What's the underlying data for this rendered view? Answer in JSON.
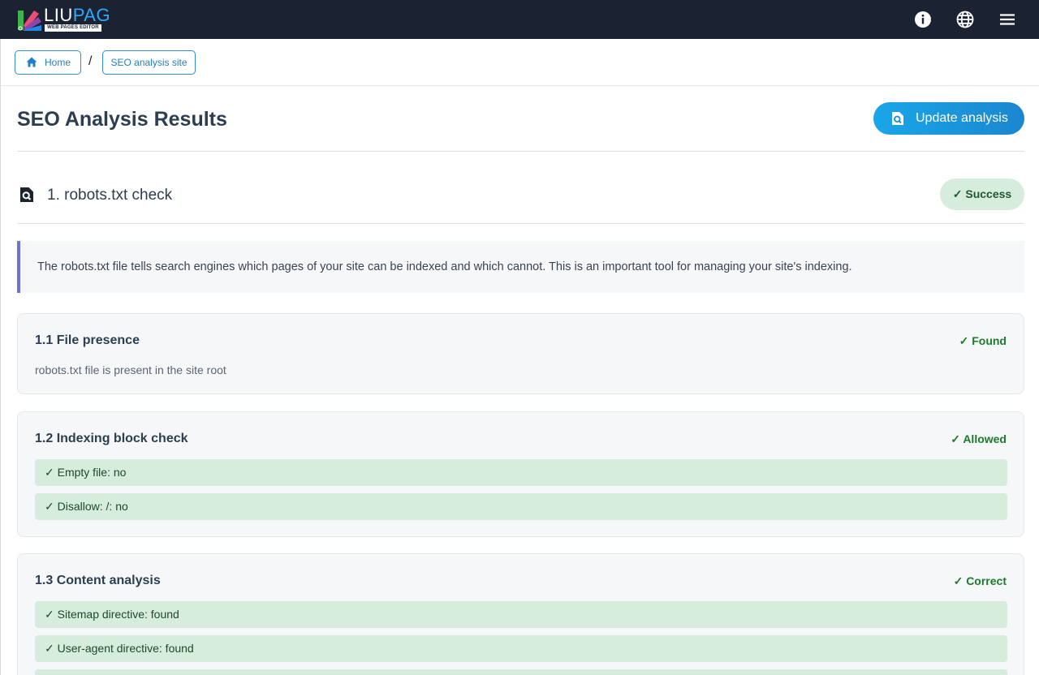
{
  "topbar": {
    "logo_part1": "LIU",
    "logo_part2": "PAG",
    "logo_sub": "WEB PAGES EDITOR"
  },
  "breadcrumb": {
    "home_label": "Home",
    "separator": "/",
    "current_label": "SEO analysis site"
  },
  "page": {
    "title": "SEO Analysis Results",
    "update_button": "Update analysis"
  },
  "section": {
    "title": "1. robots.txt check",
    "status": "✓ Success",
    "info": "The robots.txt file tells search engines which pages of your site can be indexed and which cannot. This is an important tool for managing your site's indexing."
  },
  "cards": [
    {
      "title": "1.1 File presence",
      "status": "✓ Found",
      "description": "robots.txt file is present in the site root"
    },
    {
      "title": "1.2 Indexing block check",
      "status": "✓ Allowed",
      "checks": [
        "✓  Empty file: no",
        "✓  Disallow: /: no"
      ]
    },
    {
      "title": "1.3 Content analysis",
      "status": "✓ Correct",
      "checks": [
        "✓  Sitemap directive: found",
        "✓  User-agent directive: found"
      ]
    }
  ],
  "icons": {
    "info": "info-icon",
    "language": "globe-icon",
    "menu": "hamburger-menu-icon",
    "home": "home-icon",
    "analysis": "search-document-icon"
  },
  "colors": {
    "topbar": "#1b2333",
    "accent": "#1b86cf",
    "success_bg": "#d6ecdc",
    "success_text": "#1c7a2b",
    "info_border": "#6b72d8"
  }
}
